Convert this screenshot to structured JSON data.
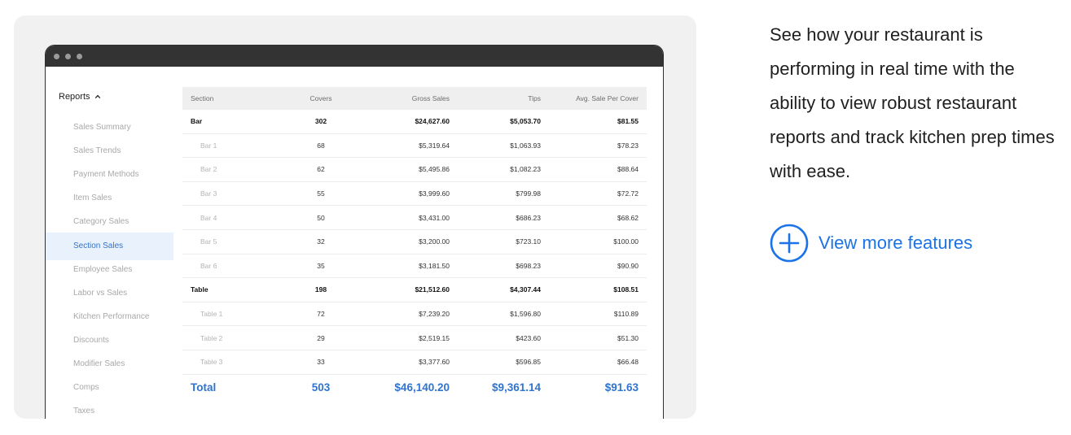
{
  "sidebar": {
    "header": "Reports",
    "items": [
      {
        "label": "Sales Summary",
        "active": false
      },
      {
        "label": "Sales Trends",
        "active": false
      },
      {
        "label": "Payment Methods",
        "active": false
      },
      {
        "label": "Item Sales",
        "active": false
      },
      {
        "label": "Category Sales",
        "active": false
      },
      {
        "label": "Section Sales",
        "active": true
      },
      {
        "label": "Employee Sales",
        "active": false
      },
      {
        "label": "Labor vs Sales",
        "active": false
      },
      {
        "label": "Kitchen Performance",
        "active": false
      },
      {
        "label": "Discounts",
        "active": false
      },
      {
        "label": "Modifier Sales",
        "active": false
      },
      {
        "label": "Comps",
        "active": false
      },
      {
        "label": "Taxes",
        "active": false
      }
    ]
  },
  "table": {
    "columns": [
      "Section",
      "Covers",
      "Gross Sales",
      "Tips",
      "Avg. Sale Per Cover"
    ],
    "rows": [
      {
        "type": "group",
        "cells": [
          "Bar",
          "302",
          "$24,627.60",
          "$5,053.70",
          "$81.55"
        ]
      },
      {
        "type": "sub",
        "cells": [
          "Bar 1",
          "68",
          "$5,319.64",
          "$1,063.93",
          "$78.23"
        ]
      },
      {
        "type": "sub",
        "cells": [
          "Bar 2",
          "62",
          "$5,495.86",
          "$1,082.23",
          "$88.64"
        ]
      },
      {
        "type": "sub",
        "cells": [
          "Bar 3",
          "55",
          "$3,999.60",
          "$799.98",
          "$72.72"
        ]
      },
      {
        "type": "sub",
        "cells": [
          "Bar 4",
          "50",
          "$3,431.00",
          "$686.23",
          "$68.62"
        ]
      },
      {
        "type": "sub",
        "cells": [
          "Bar 5",
          "32",
          "$3,200.00",
          "$723.10",
          "$100.00"
        ]
      },
      {
        "type": "sub",
        "cells": [
          "Bar 6",
          "35",
          "$3,181.50",
          "$698.23",
          "$90.90"
        ]
      },
      {
        "type": "group",
        "cells": [
          "Table",
          "198",
          "$21,512.60",
          "$4,307.44",
          "$108.51"
        ]
      },
      {
        "type": "sub",
        "cells": [
          "Table 1",
          "72",
          "$7,239.20",
          "$1,596.80",
          "$110.89"
        ]
      },
      {
        "type": "sub",
        "cells": [
          "Table 2",
          "29",
          "$2,519.15",
          "$423.60",
          "$51.30"
        ]
      },
      {
        "type": "sub",
        "cells": [
          "Table 3",
          "33",
          "$3,377.60",
          "$596.85",
          "$66.48"
        ]
      },
      {
        "type": "total",
        "cells": [
          "Total",
          "503",
          "$46,140.20",
          "$9,361.14",
          "$91.63"
        ]
      }
    ]
  },
  "description": "See how your restaurant is performing in real time with the ability to view robust restaurant reports and track kitchen prep times with ease.",
  "cta": {
    "label": "View more features",
    "icon": "plus-circle-icon"
  },
  "colors": {
    "accent": "#1a73e8",
    "active_bg": "#e8f1fc",
    "titlebar": "#333333",
    "card_bg": "#f1f1f1"
  }
}
